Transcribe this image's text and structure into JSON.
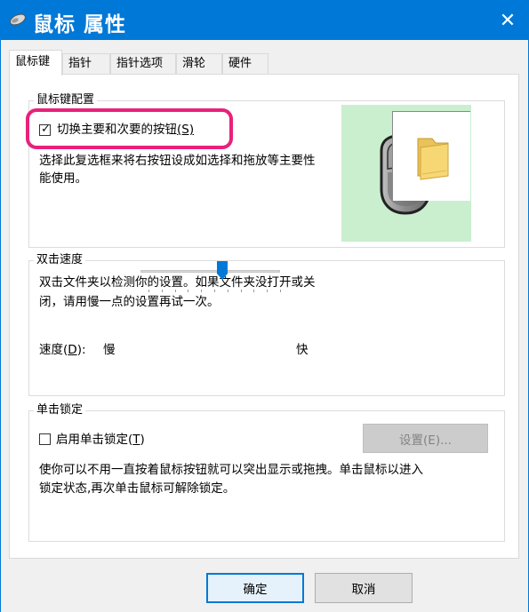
{
  "window": {
    "title": "鼠标 属性",
    "close_glyph": "✕",
    "accent": "#0078d7"
  },
  "tabs": [
    {
      "label": "鼠标键",
      "active": true
    },
    {
      "label": "指针"
    },
    {
      "label": "指针选项"
    },
    {
      "label": "滑轮"
    },
    {
      "label": "硬件"
    }
  ],
  "button_config": {
    "legend": "鼠标键配置",
    "switch_checkbox": {
      "label": "切换主要和次要的按钮",
      "mnemonic": "(S)",
      "checked": true
    },
    "description_line1": "选择此复选框来将右按钮设成如选择和拖放等主要性",
    "description_line2": "能使用。",
    "highlight_color": "#e8217a",
    "preview_bg": "#c9efcf"
  },
  "double_click": {
    "legend": "双击速度",
    "description_line1": "双击文件夹以检测你的设置。如果文件夹没打开或关",
    "description_line2": "闭，请用慢一点的设置再试一次。",
    "speed_label": "速度(",
    "speed_mnemonic": "D",
    "speed_label_end": "):",
    "slow_label": "慢",
    "fast_label": "快",
    "slider_value_fraction": 0.56
  },
  "click_lock": {
    "legend": "单击锁定",
    "checkbox_label": "启用单击锁定(",
    "checkbox_mnemonic": "T",
    "checkbox_label_end": ")",
    "checked": false,
    "settings_button": "设置(E)...",
    "description_line1": "使你可以不用一直按着鼠标按钮就可以突出显示或拖拽。单击鼠标以进入",
    "description_line2": "锁定状态,再次单击鼠标可解除锁定。"
  },
  "footer": {
    "ok_button": "确定",
    "cancel_button": "取消"
  }
}
